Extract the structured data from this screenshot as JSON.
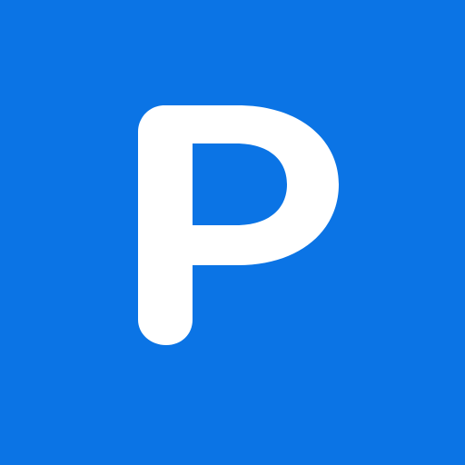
{
  "sign": {
    "letter": "P",
    "background_color": "#0b74e5",
    "letter_color": "#ffffff"
  }
}
